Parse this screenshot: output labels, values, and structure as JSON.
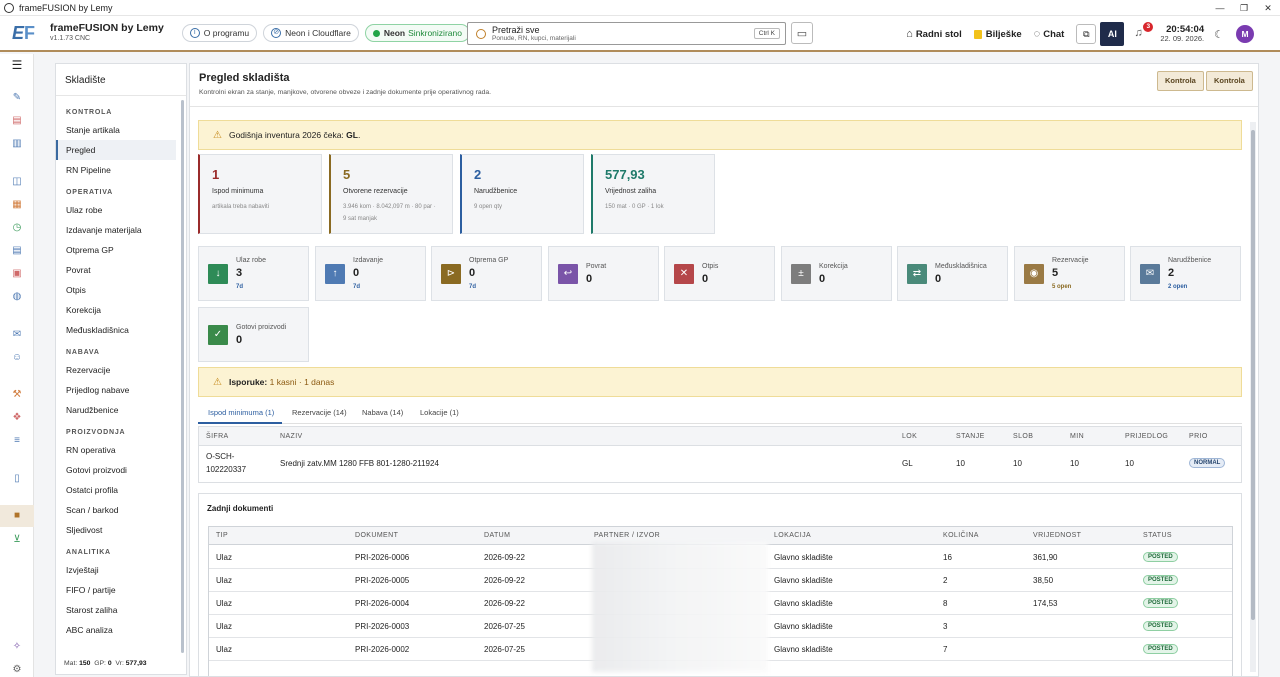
{
  "window": {
    "title": "frameFUSION by Lemy"
  },
  "header": {
    "app_name": "frameFUSION by Lemy",
    "version": "v1.1.73 CNC",
    "about_label": "O programu",
    "neon_cloudflare_label": "Neon i Cloudflare",
    "neon_label": "Neon",
    "sync_status": "Sinkronizirano",
    "search_title": "Pretraži sve",
    "search_sub": "Ponude, RN, kupci, materijali",
    "search_shortcut": "Ctrl K",
    "desktop_label": "Radni stol",
    "notes_label": "Bilješke",
    "chat_label": "Chat",
    "ai_label": "AI",
    "notif_count": "3",
    "time": "20:54:04",
    "date": "22. 09. 2026.",
    "avatar": "M"
  },
  "sidebar": {
    "title": "Skladište",
    "sections": [
      {
        "label": "KONTROLA",
        "items": [
          "Stanje artikala",
          "Pregled",
          "RN Pipeline"
        ]
      },
      {
        "label": "OPERATIVA",
        "items": [
          "Ulaz robe",
          "Izdavanje materijala",
          "Otprema GP",
          "Povrat",
          "Otpis",
          "Korekcija",
          "Međuskladišnica"
        ]
      },
      {
        "label": "NABAVA",
        "items": [
          "Rezervacije",
          "Prijedlog nabave",
          "Narudžbenice"
        ]
      },
      {
        "label": "PROIZVODNJA",
        "items": [
          "RN operativa",
          "Gotovi proizvodi",
          "Ostatci profila",
          "Scan / barkod",
          "Sljedivost"
        ]
      },
      {
        "label": "ANALITIKA",
        "items": [
          "Izvještaji",
          "FIFO / partije",
          "Starost zaliha",
          "ABC analiza"
        ]
      }
    ],
    "footer": {
      "mat_label": "Mat:",
      "mat": "150",
      "gp_label": "GP:",
      "gp": "0",
      "vr_label": "Vr:",
      "vr": "577,93"
    }
  },
  "page": {
    "title": "Pregled skladišta",
    "subtitle": "Kontrolni ekran za stanje, manjkove, otvorene obveze i zadnje dokumente prije operativnog rada.",
    "btn1": "Kontrola",
    "btn2": "Kontrola"
  },
  "alert_inventory": {
    "text": "Godišnja inventura 2026 čeka:",
    "bold": "GL",
    "end": "."
  },
  "kpis": [
    {
      "value": "1",
      "label": "Ispod minimuma",
      "sub1": "artikala treba nabaviti",
      "sub2": "",
      "color": "#9a2b2b"
    },
    {
      "value": "5",
      "label": "Otvorene rezervacije",
      "sub1": "3.946 kom · 8.042,097 m · 80 par ·",
      "sub2": "9 sat manjak",
      "color": "#8a6a22"
    },
    {
      "value": "2",
      "label": "Narudžbenice",
      "sub1": "9 open qty",
      "sub2": "",
      "color": "#2c5ea0"
    },
    {
      "value": "577,93",
      "label": "Vrijednost zaliha",
      "sub1": "150 mat · 0 GP · 1 lok",
      "sub2": "",
      "color": "#1f7a6a"
    }
  ],
  "movements": [
    {
      "label": "Ulaz robe",
      "value": "3",
      "sub": "7d",
      "icon": "↓",
      "color": "#2e8b57"
    },
    {
      "label": "Izdavanje",
      "value": "0",
      "sub": "7d",
      "icon": "↑",
      "color": "#4f7ab3"
    },
    {
      "label": "Otprema GP",
      "value": "0",
      "sub": "7d",
      "icon": "⊳",
      "color": "#8a6a22"
    },
    {
      "label": "Povrat",
      "value": "0",
      "sub": "",
      "icon": "↩",
      "color": "#7a54a8"
    },
    {
      "label": "Otpis",
      "value": "0",
      "sub": "",
      "icon": "✕",
      "color": "#b5474a"
    },
    {
      "label": "Korekcija",
      "value": "0",
      "sub": "",
      "icon": "±",
      "color": "#7d7d7d"
    },
    {
      "label": "Međuskladišnica",
      "value": "0",
      "sub": "",
      "icon": "⇄",
      "color": "#4a8a7a"
    },
    {
      "label": "Rezervacije",
      "value": "5",
      "sub": "5 open",
      "icon": "◉",
      "color": "#9a7a45"
    },
    {
      "label": "Narudžbenice",
      "value": "2",
      "sub": "2 open",
      "icon": "✉",
      "color": "#5a7a9a"
    },
    {
      "label": "Gotovi proizvodi",
      "value": "0",
      "sub": "",
      "icon": "✓",
      "color": "#3a8a4a"
    }
  ],
  "alert_deliveries": {
    "label": "Isporuke:",
    "text": "1 kasni · 1 danas"
  },
  "tabs": [
    "Ispod minimuma (1)",
    "Rezervacije (14)",
    "Nabava (14)",
    "Lokacije (1)"
  ],
  "below_min": {
    "headers": [
      "ŠIFRA",
      "NAZIV",
      "LOK",
      "STANJE",
      "SLOB",
      "MIN",
      "PRIJEDLOG",
      "PRIO"
    ],
    "rows": [
      {
        "code_1": "O-SCH-",
        "code_2": "102220337",
        "name": "Srednji zatv.MM 1280 FFB 801-1280-211924",
        "lok": "GL",
        "stanje": "10",
        "slob": "10",
        "min": "10",
        "prijedlog": "10",
        "prio": "NORMAL"
      }
    ]
  },
  "documents": {
    "title": "Zadnji dokumenti",
    "headers": [
      "TIP",
      "DOKUMENT",
      "DATUM",
      "PARTNER / IZVOR",
      "LOKACIJA",
      "KOLIČINA",
      "VRIJEDNOST",
      "STATUS"
    ],
    "rows": [
      {
        "tip": "Ulaz",
        "doc": "PRI-2026-0006",
        "date": "2026-09-22",
        "loc": "Glavno skladište",
        "qty": "16",
        "val": "361,90",
        "status": "POSTED"
      },
      {
        "tip": "Ulaz",
        "doc": "PRI-2026-0005",
        "date": "2026-09-22",
        "loc": "Glavno skladište",
        "qty": "2",
        "val": "38,50",
        "status": "POSTED"
      },
      {
        "tip": "Ulaz",
        "doc": "PRI-2026-0004",
        "date": "2026-09-22",
        "loc": "Glavno skladište",
        "qty": "8",
        "val": "174,53",
        "status": "POSTED"
      },
      {
        "tip": "Ulaz",
        "doc": "PRI-2026-0003",
        "date": "2026-07-25",
        "loc": "Glavno skladište",
        "qty": "3",
        "val": "",
        "status": "POSTED"
      },
      {
        "tip": "Ulaz",
        "doc": "PRI-2026-0002",
        "date": "2026-07-25",
        "loc": "Glavno skladište",
        "qty": "7",
        "val": "",
        "status": "POSTED"
      }
    ]
  }
}
